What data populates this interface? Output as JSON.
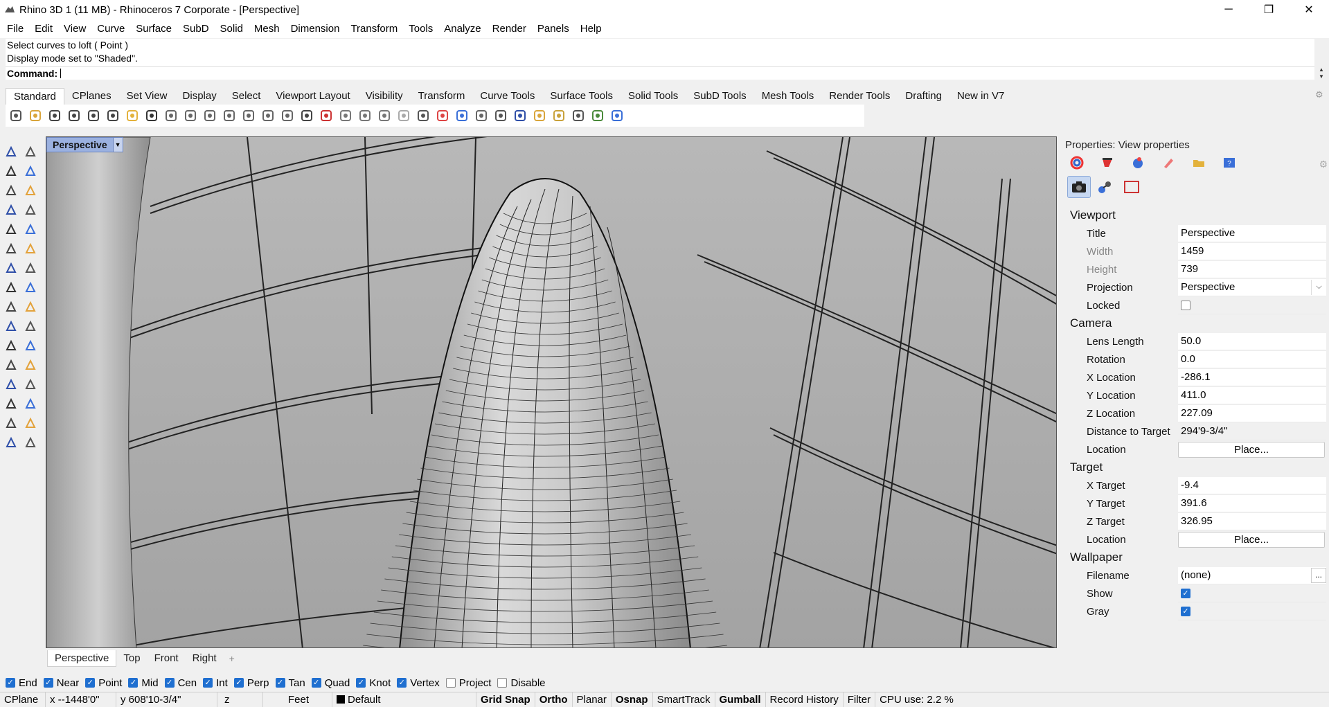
{
  "window": {
    "title": "Rhino 3D 1 (11 MB) - Rhinoceros 7 Corporate - [Perspective]",
    "minimize": "─",
    "maximize": "❐",
    "close": "✕"
  },
  "menu": [
    "File",
    "Edit",
    "View",
    "Curve",
    "Surface",
    "SubD",
    "Solid",
    "Mesh",
    "Dimension",
    "Transform",
    "Tools",
    "Analyze",
    "Render",
    "Panels",
    "Help"
  ],
  "command": {
    "history": [
      "Select curves to loft ( Point )",
      "Display mode set to \"Shaded\"."
    ],
    "label": "Command:"
  },
  "toolbar_tabs": [
    "Standard",
    "CPlanes",
    "Set View",
    "Display",
    "Select",
    "Viewport Layout",
    "Visibility",
    "Transform",
    "Curve Tools",
    "Surface Tools",
    "Solid Tools",
    "SubD Tools",
    "Mesh Tools",
    "Render Tools",
    "Drafting",
    "New in V7"
  ],
  "toolbar_active": "Standard",
  "standard_icons": [
    "new-icon",
    "open-icon",
    "save-icon",
    "print-icon",
    "import-icon",
    "copy-icon",
    "paste-icon",
    "undo-icon",
    "pan-icon",
    "rotate-view-icon",
    "zoom-icon",
    "zoom-window-icon",
    "zoom-extents-icon",
    "zoom-selected-icon",
    "rotate-icon",
    "four-views-icon",
    "car-icon",
    "hide-icon",
    "show-icon",
    "select-icon",
    "light-icon",
    "lock-icon",
    "material-icon",
    "color-icon",
    "sphere-render-icon",
    "sphere-shaded-icon",
    "sphere-rendered-icon",
    "pointer-tool-icon",
    "gear-tools-icon",
    "snap-icon",
    "globe-icon",
    "help-icon"
  ],
  "left_tools": [
    "select-arrow-icon",
    "point-icon",
    "polyline-icon",
    "curve-icon",
    "circle-icon",
    "ellipse-icon",
    "arc-icon",
    "rectangle-icon",
    "polygon-icon",
    "fillet-icon",
    "surface-icon",
    "edge-surface-icon",
    "box-icon",
    "sphere-icon",
    "cylinder-icon",
    "extrude-icon",
    "explode-icon",
    "join-icon",
    "boolean-icon",
    "group-icon",
    "trim-icon",
    "split-icon",
    "text-icon",
    "dimension-icon",
    "array-icon",
    "block-icon",
    "grid-icon",
    "record-icon",
    "analyze-icon",
    "check-icon",
    "render-icon",
    "paint-icon"
  ],
  "viewport": {
    "name": "Perspective",
    "dropdown": "▼"
  },
  "view_tabs": [
    "Perspective",
    "Top",
    "Front",
    "Right"
  ],
  "view_tab_active": "Perspective",
  "view_tab_add": "+",
  "osnaps": [
    {
      "label": "End",
      "checked": true
    },
    {
      "label": "Near",
      "checked": true
    },
    {
      "label": "Point",
      "checked": true
    },
    {
      "label": "Mid",
      "checked": true
    },
    {
      "label": "Cen",
      "checked": true
    },
    {
      "label": "Int",
      "checked": true
    },
    {
      "label": "Perp",
      "checked": true
    },
    {
      "label": "Tan",
      "checked": true
    },
    {
      "label": "Quad",
      "checked": true
    },
    {
      "label": "Knot",
      "checked": true
    },
    {
      "label": "Vertex",
      "checked": true
    },
    {
      "label": "Project",
      "checked": false
    },
    {
      "label": "Disable",
      "checked": false
    }
  ],
  "status": {
    "cplane": "CPlane",
    "x": "x --1448'0\"",
    "y": "y 608'10-3/4\"",
    "z": "z",
    "units": "Feet",
    "layer": "Default",
    "grid_snap": "Grid Snap",
    "ortho": "Ortho",
    "planar": "Planar",
    "osnap": "Osnap",
    "smarttrack": "SmartTrack",
    "gumball": "Gumball",
    "record_history": "Record History",
    "filter": "Filter",
    "cpu": "CPU use: 2.2 %"
  },
  "properties": {
    "title": "Properties: View properties",
    "sections": {
      "viewport": "Viewport",
      "camera": "Camera",
      "target": "Target",
      "wallpaper": "Wallpaper"
    },
    "viewport": {
      "title_label": "Title",
      "title_value": "Perspective",
      "width_label": "Width",
      "width_value": "1459",
      "height_label": "Height",
      "height_value": "739",
      "projection_label": "Projection",
      "projection_value": "Perspective",
      "locked_label": "Locked"
    },
    "camera": {
      "lens_label": "Lens Length",
      "lens_value": "50.0",
      "rotation_label": "Rotation",
      "rotation_value": "0.0",
      "xloc_label": "X Location",
      "xloc_value": "-286.1",
      "yloc_label": "Y Location",
      "yloc_value": "411.0",
      "zloc_label": "Z Location",
      "zloc_value": "227.09",
      "dist_label": "Distance to Target",
      "dist_value": "294'9-3/4\"",
      "location_label": "Location",
      "place_button": "Place..."
    },
    "target": {
      "x_label": "X Target",
      "x_value": "-9.4",
      "y_label": "Y Target",
      "y_value": "391.6",
      "z_label": "Z Target",
      "z_value": "326.95",
      "location_label": "Location",
      "place_button": "Place..."
    },
    "wallpaper": {
      "filename_label": "Filename",
      "filename_value": "(none)",
      "browse": "...",
      "show_label": "Show",
      "gray_label": "Gray"
    }
  }
}
